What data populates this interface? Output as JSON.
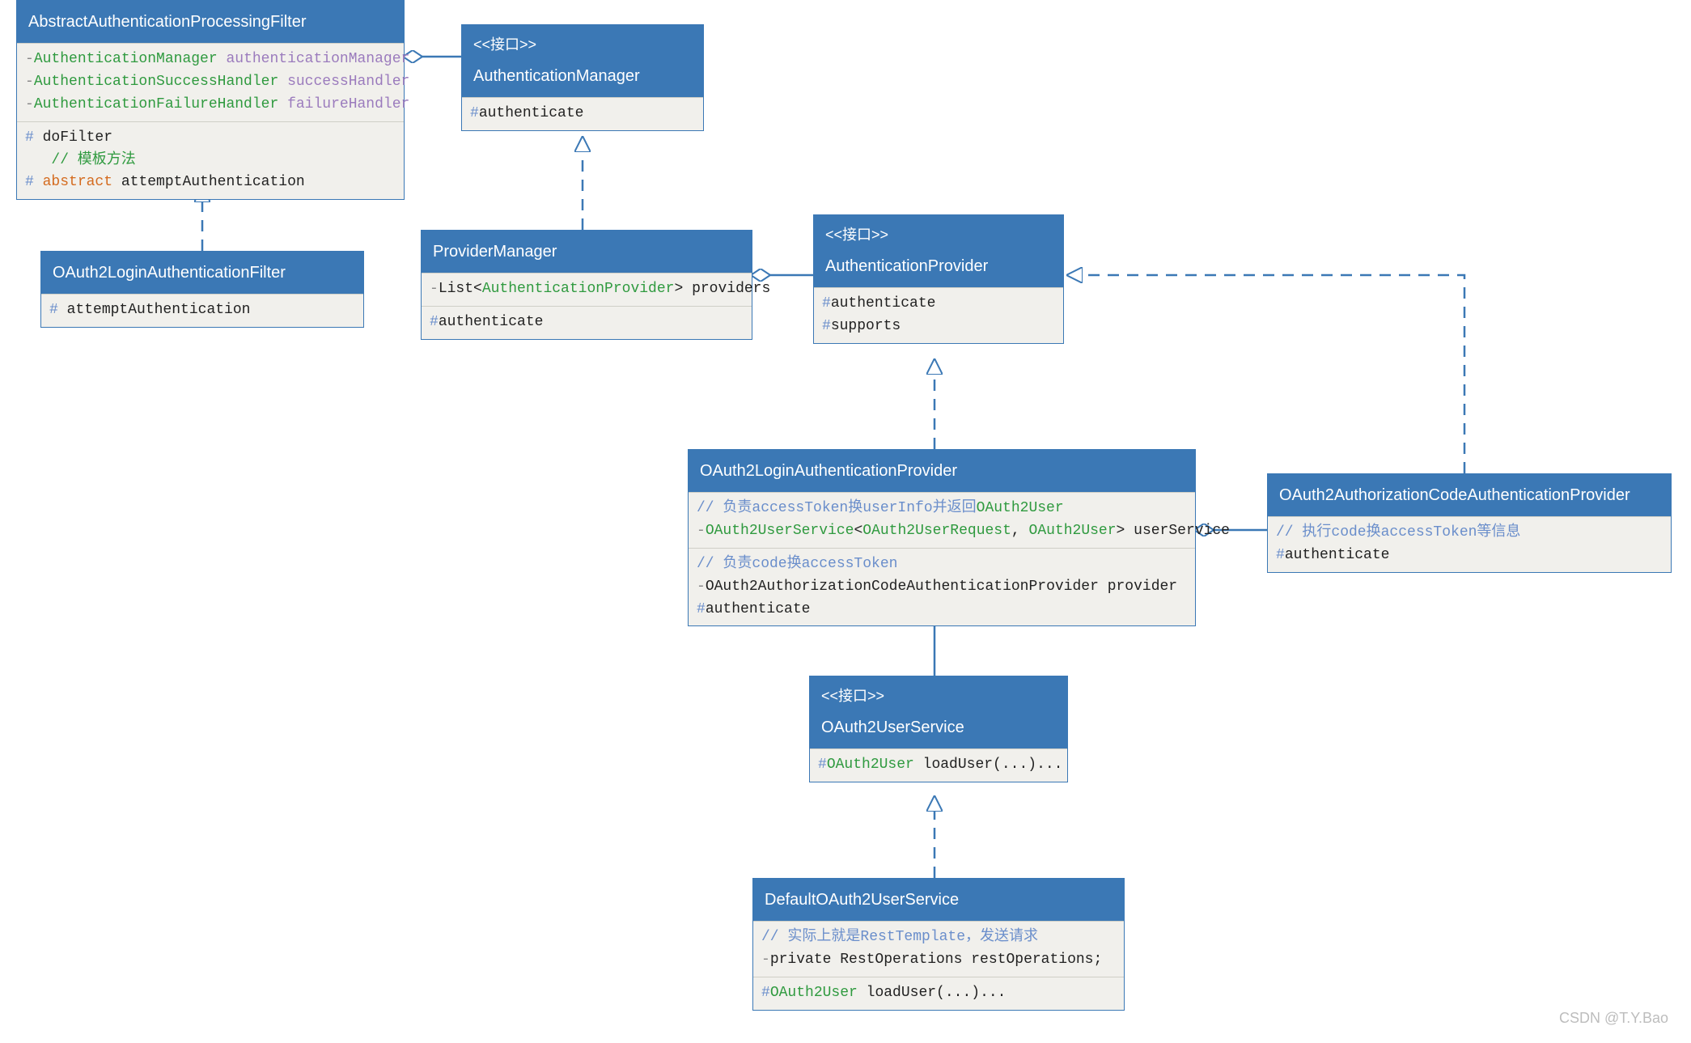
{
  "diagram": {
    "stereotype_interface": "<<接口>>",
    "watermark": "CSDN @T.Y.Bao"
  },
  "classes": {
    "abstractFilter": {
      "title": "AbstractAuthenticationProcessingFilter",
      "attr1_type": "AuthenticationManager",
      "attr1_name": "authenticationManager",
      "attr2_type": "AuthenticationSuccessHandler",
      "attr2_name": "successHandler",
      "attr3_type": "AuthenticationFailureHandler",
      "attr3_name": "failureHandler",
      "op1": "doFilter",
      "op_comment": "// 模板方法",
      "op2_kw": "abstract",
      "op2_name": "attemptAuthentication"
    },
    "oauth2LoginFilter": {
      "title": "OAuth2LoginAuthenticationFilter",
      "op1": "attemptAuthentication"
    },
    "authManager": {
      "title": "AuthenticationManager",
      "op1": "authenticate"
    },
    "providerManager": {
      "title": "ProviderManager",
      "attr1_pre": "List<",
      "attr1_type": "AuthenticationProvider",
      "attr1_post": "> providers",
      "op1": "authenticate"
    },
    "authProvider": {
      "title": "AuthenticationProvider",
      "op1": "authenticate",
      "op2": "supports"
    },
    "oauth2LoginProvider": {
      "title": "OAuth2LoginAuthenticationProvider",
      "cmt1": "// 负责accessToken换userInfo并返回",
      "cmt1_type": "OAuth2User",
      "attr1_type": "OAuth2UserService",
      "attr1_gen_open": "<",
      "attr1_gen_a": "OAuth2UserRequest",
      "attr1_gen_sep": ", ",
      "attr1_gen_b": "OAuth2User",
      "attr1_gen_close": "> userService",
      "cmt2": "// 负责code换accessToken",
      "attr2": "OAuth2AuthorizationCodeAuthenticationProvider provider",
      "op1": "authenticate"
    },
    "oauth2CodeProvider": {
      "title": "OAuth2AuthorizationCodeAuthenticationProvider",
      "cmt1": "// 执行code换accessToken等信息",
      "op1": "authenticate"
    },
    "oauth2UserService": {
      "title": "OAuth2UserService",
      "op1_type": "OAuth2User",
      "op1_rest": " loadUser(...)..."
    },
    "defaultOAuth2UserService": {
      "title": "DefaultOAuth2UserService",
      "cmt1": "// 实际上就是RestTemplate，发送请求",
      "attr1": "private RestOperations restOperations;",
      "op1_type": "OAuth2User",
      "op1_rest": " loadUser(...)..."
    }
  }
}
